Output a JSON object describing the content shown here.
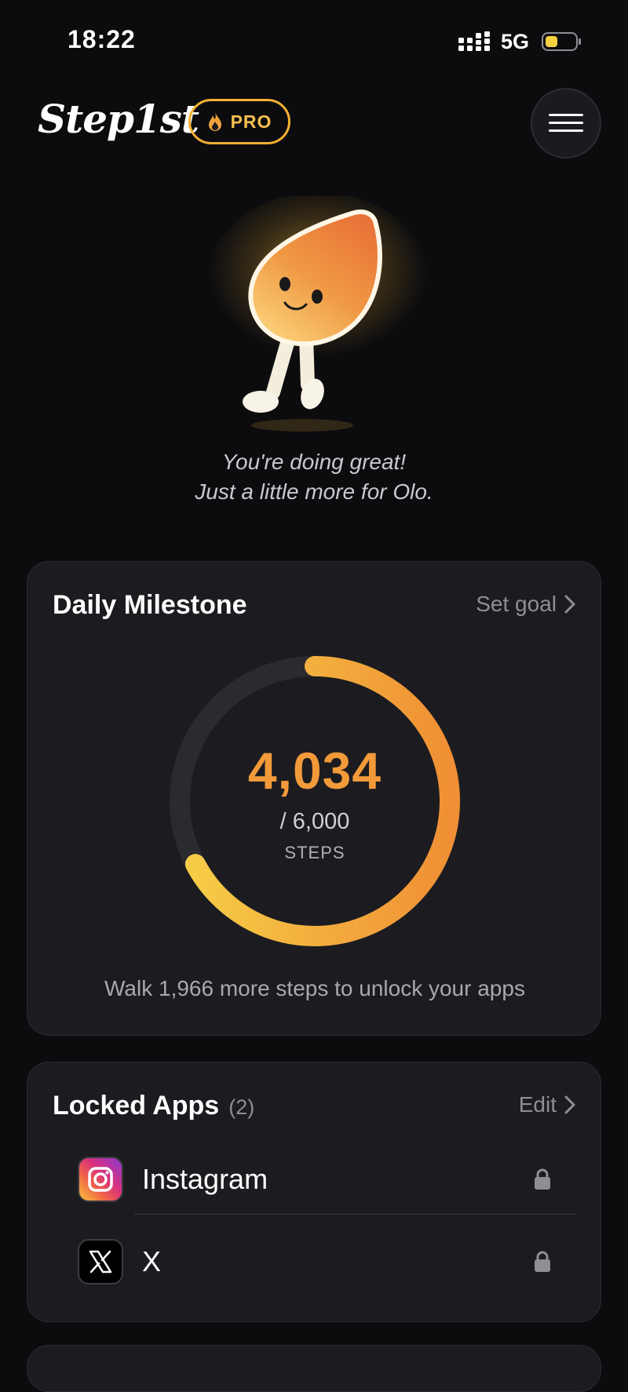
{
  "status_bar": {
    "time": "18:22",
    "network": "5G"
  },
  "header": {
    "app_name": "Step1st",
    "badge_label": "PRO"
  },
  "mascot": {
    "message_line1": "You're doing great!",
    "message_line2": "Just a little more for Olo."
  },
  "milestone": {
    "title": "Daily Milestone",
    "link_label": "Set goal",
    "steps_display": "4,034",
    "goal_display": "/ 6,000",
    "unit": "STEPS",
    "steps": 4034,
    "goal": 6000,
    "unlock_message": "Walk 1,966 more steps to unlock your apps"
  },
  "locked_apps": {
    "title": "Locked Apps",
    "count_label": "(2)",
    "link_label": "Edit",
    "apps": [
      {
        "name": "Instagram",
        "icon": "instagram-icon",
        "locked": true
      },
      {
        "name": "X",
        "icon": "x-icon",
        "locked": true
      }
    ]
  },
  "colors": {
    "background": "#0c0c0f",
    "card": "#1c1c20",
    "accent_orange": "#f29a3a",
    "accent_yellow": "#f6c945",
    "muted_text": "#8e8e93"
  }
}
